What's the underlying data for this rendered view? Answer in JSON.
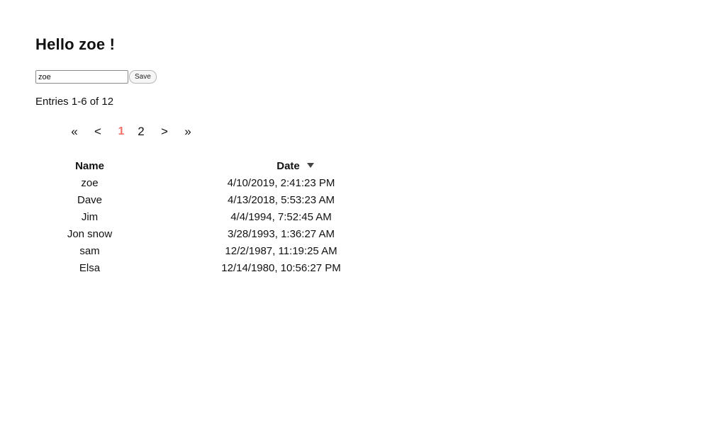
{
  "header": {
    "greeting": "Hello zoe !"
  },
  "name_form": {
    "input_value": "zoe",
    "save_label": "Save"
  },
  "entries_info": "Entries 1-6 of 12",
  "pagination": {
    "first": "«",
    "prev": "<",
    "current": "1",
    "next_page": "2",
    "next": ">",
    "last": "»"
  },
  "table": {
    "columns": {
      "name": "Name",
      "date": "Date"
    },
    "sort": {
      "column": "Date",
      "direction": "descending",
      "icon": "sort-desc-triangle-icon"
    },
    "rows": [
      {
        "name": "zoe",
        "date": "4/10/2019, 2:41:23 PM"
      },
      {
        "name": "Dave",
        "date": "4/13/2018, 5:53:23 AM"
      },
      {
        "name": "Jim",
        "date": "4/4/1994, 7:52:45 AM"
      },
      {
        "name": "Jon snow",
        "date": "3/28/1993, 1:36:27 AM"
      },
      {
        "name": "sam",
        "date": "12/2/1987, 11:19:25 AM"
      },
      {
        "name": "Elsa",
        "date": "12/14/1980, 10:56:27 PM"
      }
    ]
  },
  "colors": {
    "current_page": "#f07067",
    "text": "#111111"
  }
}
